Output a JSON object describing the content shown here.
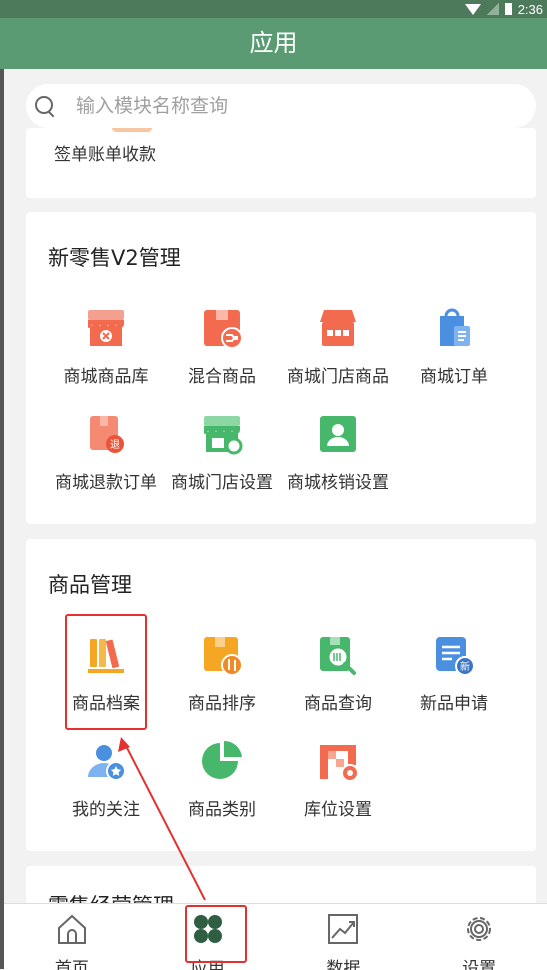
{
  "status": {
    "time": "2:36"
  },
  "header": {
    "title": "应用"
  },
  "search": {
    "placeholder": "输入模块名称查询"
  },
  "top_card": {
    "label": "签单账单收款"
  },
  "sections": [
    {
      "title": "新零售V2管理",
      "items": [
        {
          "label": "商城商品库",
          "icon": "mall-goods-store-icon"
        },
        {
          "label": "混合商品",
          "icon": "mixed-goods-icon"
        },
        {
          "label": "商城门店商品",
          "icon": "mall-store-goods-icon"
        },
        {
          "label": "商城订单",
          "icon": "mall-order-bag-icon"
        },
        {
          "label": "商城退款订单",
          "icon": "refund-order-icon"
        },
        {
          "label": "商城门店设置",
          "icon": "store-settings-icon"
        },
        {
          "label": "商城核销设置",
          "icon": "verify-settings-icon"
        }
      ]
    },
    {
      "title": "商品管理",
      "items": [
        {
          "label": "商品档案",
          "icon": "goods-archive-books-icon"
        },
        {
          "label": "商品排序",
          "icon": "goods-sort-icon"
        },
        {
          "label": "商品查询",
          "icon": "goods-search-icon"
        },
        {
          "label": "新品申请",
          "icon": "new-goods-apply-icon"
        },
        {
          "label": "我的关注",
          "icon": "my-follow-user-icon"
        },
        {
          "label": "商品类别",
          "icon": "goods-category-pie-icon"
        },
        {
          "label": "库位设置",
          "icon": "storage-settings-icon"
        }
      ]
    },
    {
      "title": "零售经营管理"
    }
  ],
  "tabs": [
    {
      "label": "首页",
      "icon": "home-icon"
    },
    {
      "label": "应用",
      "icon": "apps-icon"
    },
    {
      "label": "数据",
      "icon": "chart-icon"
    },
    {
      "label": "设置",
      "icon": "settings-gear-icon"
    }
  ],
  "colors": {
    "header": "#5a9b73",
    "accent_red": "#e53030",
    "orange": "#f26b4f",
    "blue": "#4a8fe0",
    "green": "#47b86b"
  }
}
